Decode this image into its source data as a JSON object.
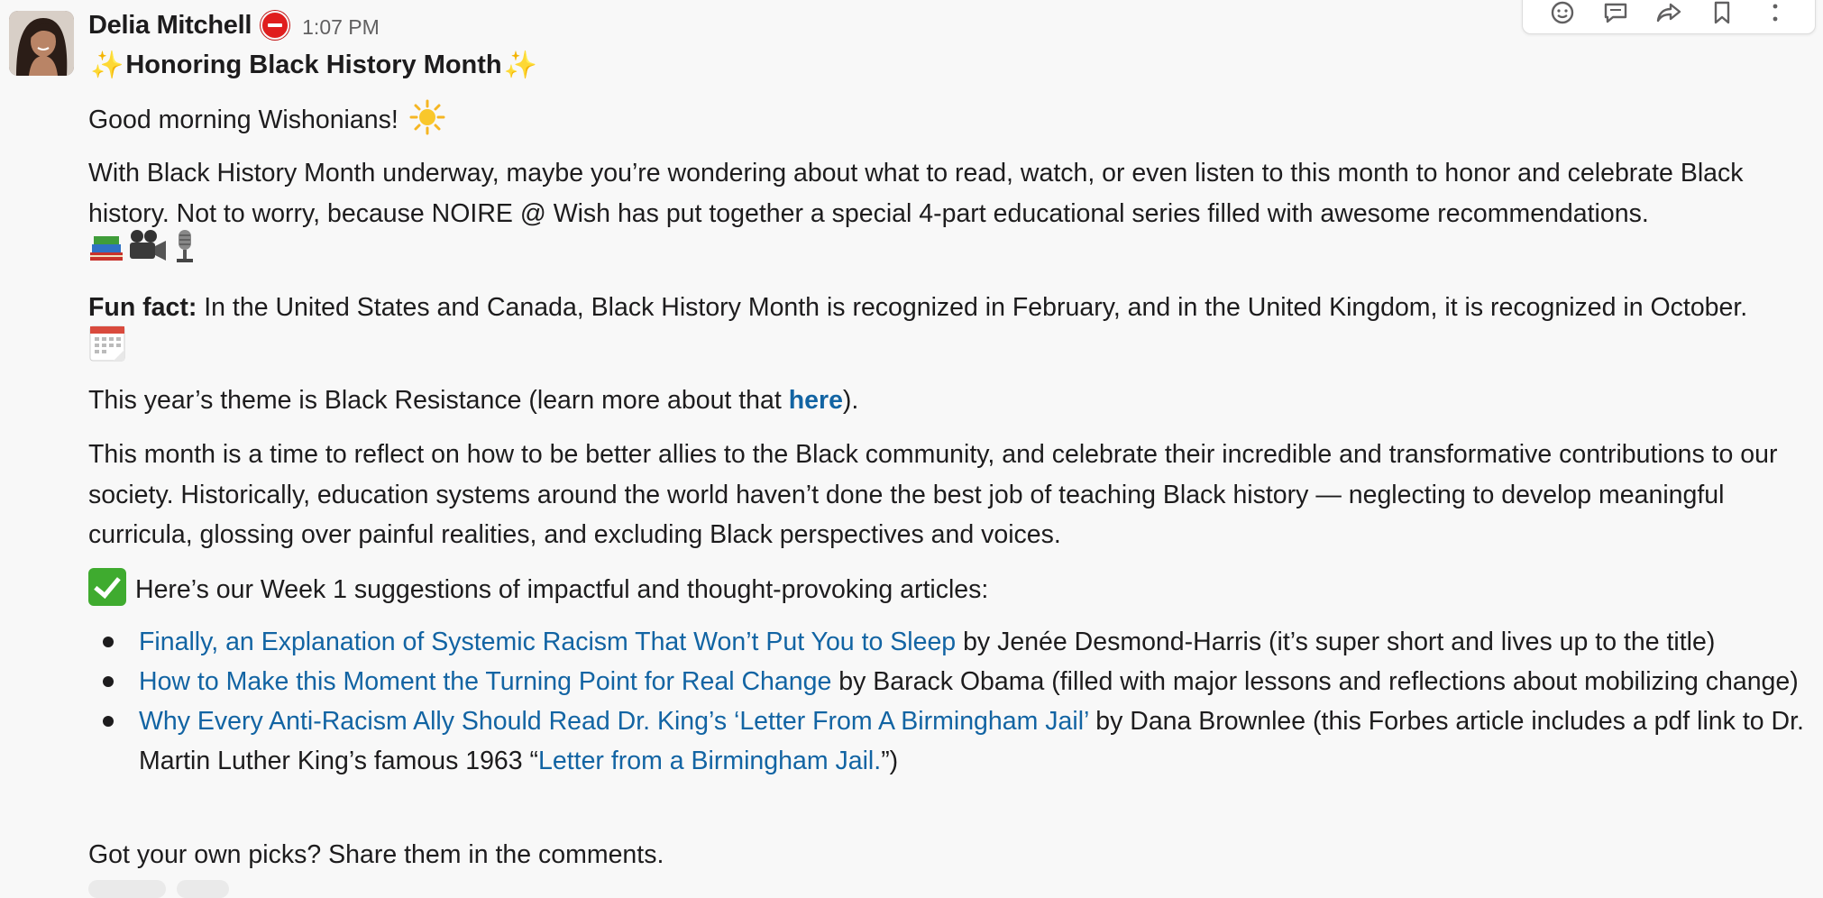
{
  "message": {
    "sender": "Delia Mitchell",
    "time": "1:07 PM",
    "title": "Honoring Black History Month",
    "greeting": "Good morning Wishonians!",
    "intro": "With Black History Month underway, maybe you’re wondering about what to read, watch, or even listen to this month to honor and celebrate Black history. Not to worry, because NOIRE @ Wish has put together a special 4-part educational series filled with awesome recommendations.",
    "fun_fact_label": "Fun fact:",
    "fun_fact_text": " In the United States and Canada, Black History Month is recognized  in February, and in the United Kingdom, it is recognized in October.",
    "theme_prefix": "This year’s theme is Black Resistance (learn more about that ",
    "theme_link": "here",
    "theme_suffix": ").",
    "reflect": "This month is a time to reflect on how to be better allies to the Black community, and celebrate their incredible and transformative contributions to our society.  Historically, education systems around the world haven’t done the best job of teaching Black history — neglecting to develop meaningful curricula, glossing over painful realities, and excluding Black perspectives and voices.",
    "week_intro": "Here’s our Week 1 suggestions of  impactful and thought-provoking articles:",
    "articles": [
      {
        "link": "Finally, an Explanation of Systemic Racism That Won’t Put You to Sleep",
        "rest": " by Jenée Desmond-Harris  (it’s super short and lives up to the title)"
      },
      {
        "link": "How to Make this Moment the Turning Point for Real Change",
        "rest": " by Barack Obama (filled with major lessons and reflections about mobilizing change)"
      },
      {
        "link": "Why Every Anti-Racism Ally Should Read Dr. King’s ‘Letter From A Birmingham Jail’",
        "rest": " by Dana Brownlee (this Forbes article includes a pdf link to Dr. Martin Luther King’s famous 1963 “",
        "link2": "Letter from a Birmingham Jail.",
        "rest2": "”)"
      }
    ],
    "closing": "Got your own picks? Share them in the comments."
  },
  "icons": {
    "status": "do-not-disturb-icon",
    "sparkle": "sparkles-emoji",
    "sun": "sun-emoji",
    "media": [
      "books-emoji",
      "movie-camera-emoji",
      "microphone-emoji"
    ],
    "calendar": "calendar-emoji",
    "check": "check-mark-emoji"
  },
  "toolbar": [
    "add-reaction-icon",
    "reply-in-thread-icon",
    "share-message-icon",
    "save-icon",
    "more-actions-icon"
  ],
  "colors": {
    "background": "#f8f8f8",
    "link": "#1264a3",
    "text": "#1d1c1d",
    "timestamp": "#616061",
    "status_red": "#e01e1e",
    "check_green": "#3fab2f"
  }
}
